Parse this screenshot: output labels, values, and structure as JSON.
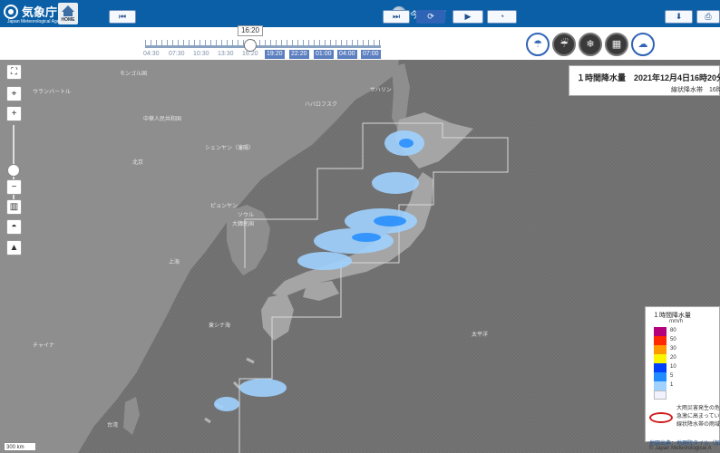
{
  "header": {
    "logo_jp": "気象庁",
    "logo_en": "Japan Meteorological Agency",
    "home_label": "HOME",
    "mode_label": "今後の雨",
    "mode_caret": "▼"
  },
  "timeline": {
    "current_time": "16:20",
    "past_times": [
      "04:30",
      "07:30",
      "10:30",
      "13:30",
      "16:20"
    ],
    "forecast_times": [
      "19:20",
      "22:20",
      "01:00",
      "04:00",
      "07:00"
    ],
    "first_label": "⏮",
    "last_label": "⏭",
    "refresh_label": "⟳",
    "play_label": "▶",
    "speed_label": "◔"
  },
  "toolbar": {
    "layer_buttons": [
      "☂",
      "☔",
      "❄",
      "▦",
      "☁"
    ],
    "download_label": "⬇",
    "print_label": "⎙"
  },
  "map_controls": {
    "fullscreen": "⛶",
    "location": "⌖",
    "zoom_in": "+",
    "zoom_out": "−",
    "basemap": "▥",
    "terrain_a": "◓",
    "terrain_b": "▲",
    "zoom_level_fraction": 0.4
  },
  "info_panel": {
    "title": "１時間降水量　2021年12月4日16時20分",
    "sub": "線状降水帯　16時"
  },
  "legend": {
    "title": "１時間降水量",
    "unit": "mm/h",
    "levels": [
      {
        "label": "80",
        "color": "#b4007b"
      },
      {
        "label": "50",
        "color": "#ff2800"
      },
      {
        "label": "30",
        "color": "#ff9900"
      },
      {
        "label": "20",
        "color": "#faf500"
      },
      {
        "label": "10",
        "color": "#0041ff"
      },
      {
        "label": "5",
        "color": "#218cff"
      },
      {
        "label": "1",
        "color": "#a0d2ff"
      },
      {
        "label": "",
        "color": "#f2f2ff"
      }
    ],
    "notes": [
      "大雨災害発生の危",
      "急激に高まってい",
      "線状降水帯の雨域"
    ]
  },
  "map": {
    "labels": [
      "ウランバートル",
      "モンゴル国",
      "中華人民共和国",
      "シェンヤン（瀋陽）",
      "北京",
      "大韓民国",
      "ピョンヤン",
      "ソウル",
      "上海",
      "チャイナ",
      "東シナ海",
      "台湾",
      "太平洋",
      "ハバロフスク",
      "サハリン"
    ],
    "scale": "300 km",
    "credit1": "地図出典：地理院タイル（加工",
    "credit2": "© Japan Meteorological A"
  },
  "colors": {
    "header_bg": "#0a5fa6",
    "accent": "#2e63b5",
    "land": "#8e8e8e",
    "sea": "#6d6d6d"
  }
}
